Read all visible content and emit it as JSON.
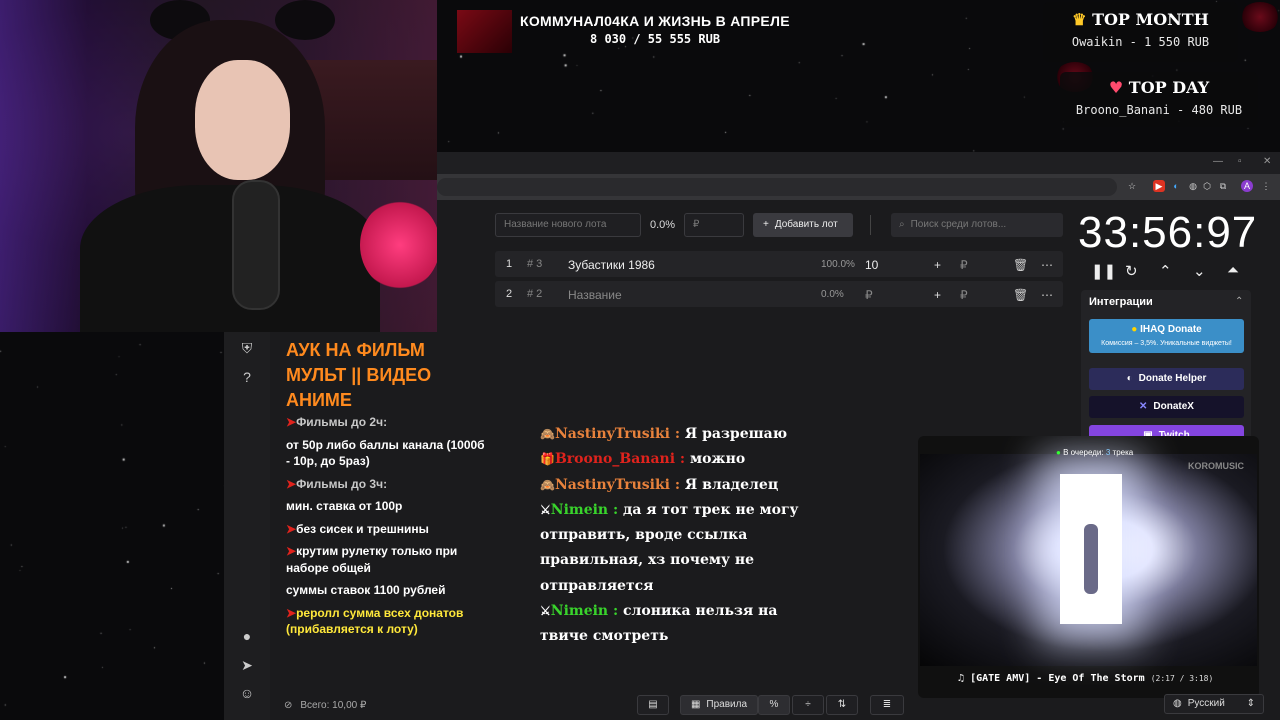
{
  "goal": {
    "title": "КОММУНАЛ04КА И ЖИЗНЬ В АПРЕЛЕ",
    "amount": "8 030 / 55 555 RUB"
  },
  "top_month": {
    "title": "TOP MONTH",
    "entry": "Owaikin - 1 550 RUB"
  },
  "top_day": {
    "title": "TOP DAY",
    "entry": "Broono_Banani - 480 RUB"
  },
  "rules": {
    "title": "АУК НА ФИЛЬМ МУЛЬТ || ВИДЕО АНИМЕ",
    "items": [
      {
        "arrow": "➤",
        "text": "Фильмы до 2ч:",
        "style": "hdr"
      },
      {
        "arrow": "",
        "text": "от 50р либо баллы канала (1000б - 10р, до 5раз)",
        "style": "plain"
      },
      {
        "arrow": "➤",
        "text": "Фильмы до 3ч:",
        "style": "hdr"
      },
      {
        "arrow": "",
        "text": "мин. ставка от 100р",
        "style": "plain"
      },
      {
        "arrow": "➤",
        "text": "без сисек и трешнины",
        "style": "plain"
      },
      {
        "arrow": "➤",
        "text": "крутим рулетку только при наборе общей",
        "style": "plain"
      },
      {
        "arrow": "",
        "text": "суммы ставок 1100 рублей",
        "style": "plain"
      },
      {
        "arrow": "➤",
        "text": "реролл сумма всех донатов (прибавляется к лоту)",
        "style": "yellow"
      }
    ],
    "total_label": "Всего: 10,00 ₽"
  },
  "controls": {
    "new_lot_placeholder": "Название нового лота",
    "percent": "0.0%",
    "amount_placeholder": "₽",
    "add_button": "Добавить лот",
    "search_placeholder": "Поиск среди лотов..."
  },
  "lots": [
    {
      "index": "1",
      "id": "# 3",
      "name": "Зубастики 1986",
      "percent": "100.0%",
      "amount": "10"
    },
    {
      "index": "2",
      "id": "# 2",
      "name": "Название",
      "percent": "0.0%",
      "amount": "₽"
    }
  ],
  "timer": "33:56:97",
  "integrations": {
    "title": "Интеграции",
    "ihaq": {
      "label": "IHAQ Donate",
      "sub": "Комиссия – 3,5%. Уникальные виджеты!"
    },
    "buttons": [
      "Donate Helper",
      "DonateX",
      "Twitch"
    ]
  },
  "chat": [
    {
      "emoji": "🙈",
      "name": "NastinyTrusiki",
      "color": "orange",
      "text": "Я разрешаю"
    },
    {
      "emoji": "🎁",
      "name": "Broono_Banani",
      "color": "red",
      "text": "можно"
    },
    {
      "emoji": "🙈",
      "name": "NastinyTrusiki",
      "color": "orange",
      "text": "Я владелец"
    },
    {
      "emoji": "⚔",
      "name": "Nimein",
      "color": "green",
      "text": "да я тот трек не могу отправить, вроде ссылка правильная, хз почему не отправляется"
    },
    {
      "emoji": "⚔",
      "name": "Nimein",
      "color": "green",
      "text": "слоника нельзя на твиче смотреть"
    }
  ],
  "music": {
    "queue_label": "В очереди:",
    "queue_count": "3",
    "queue_suffix": "трека",
    "brand": "KOROMUSIC",
    "track": "[GATE AMV] - Eye Of The Storm",
    "time": "(2:17 / 3:18)"
  },
  "toolbar": {
    "rules_button": "Правила",
    "percent_button": "%"
  },
  "language": "Русский"
}
